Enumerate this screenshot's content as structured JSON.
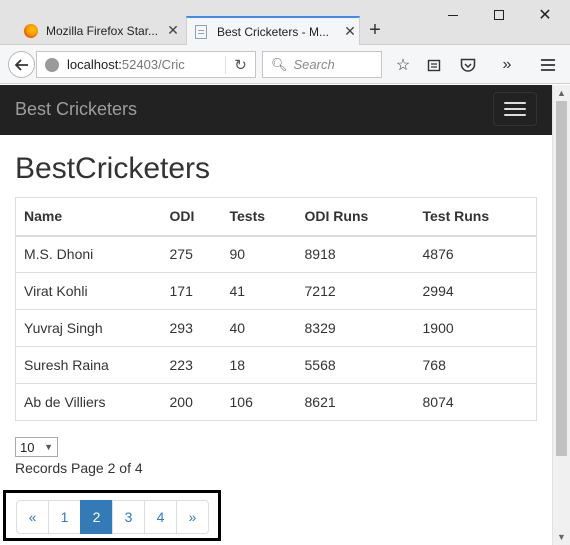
{
  "browser": {
    "tabs": [
      {
        "title": "Mozilla Firefox Star...",
        "icon": "firefox-logo-icon",
        "active": false
      },
      {
        "title": "Best Cricketers - M...",
        "icon": "page-icon",
        "active": true
      }
    ],
    "new_tab_symbol": "+",
    "url_host": "localhost:",
    "url_rest": "52403/Cric",
    "search_placeholder": "Search",
    "accent": "#3e8cf0"
  },
  "site": {
    "brand": "Best Cricketers",
    "nav_bg": "#222222"
  },
  "page": {
    "title": "BestCricketers",
    "table": {
      "headers": [
        "Name",
        "ODI",
        "Tests",
        "ODI Runs",
        "Test Runs"
      ],
      "rows": [
        [
          "M.S. Dhoni",
          "275",
          "90",
          "8918",
          "4876"
        ],
        [
          "Virat Kohli",
          "171",
          "41",
          "7212",
          "2994"
        ],
        [
          "Yuvraj Singh",
          "293",
          "40",
          "8329",
          "1900"
        ],
        [
          "Suresh Raina",
          "223",
          "18",
          "5568",
          "768"
        ],
        [
          "Ab de Villiers",
          "200",
          "106",
          "8621",
          "8074"
        ]
      ]
    },
    "page_size": "10",
    "records_text": "Records Page 2 of 4",
    "pagination": {
      "items": [
        "«",
        "1",
        "2",
        "3",
        "4",
        "»"
      ],
      "active": "2",
      "active_color": "#337ab7"
    }
  }
}
